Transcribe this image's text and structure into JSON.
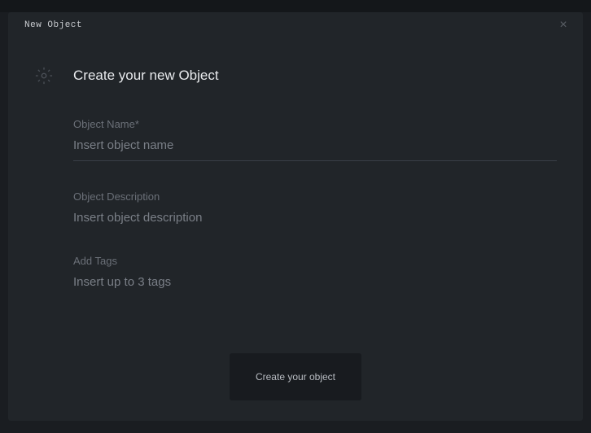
{
  "modal": {
    "title": "New Object",
    "close_symbol": "×"
  },
  "header": {
    "title": "Create your new Object"
  },
  "fields": {
    "name": {
      "label": "Object Name*",
      "placeholder": "Insert object name",
      "value": ""
    },
    "description": {
      "label": "Object Description",
      "placeholder": "Insert object description",
      "value": ""
    },
    "tags": {
      "label": "Add Tags",
      "placeholder": "Insert up to 3 tags",
      "value": ""
    }
  },
  "footer": {
    "submit_label": "Create your object"
  }
}
